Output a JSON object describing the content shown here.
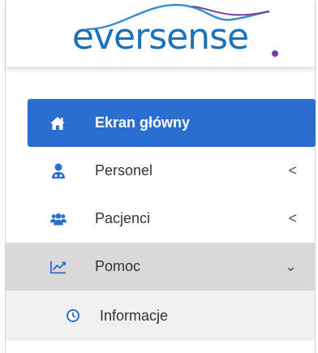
{
  "brand": {
    "logo_text": "eversense",
    "colors": {
      "primary": "#1a73b8",
      "accent": "#7b3fa0",
      "active_item_bg": "#2a6fcf",
      "expanded_item_bg": "#d9d9d9",
      "submenu_bg": "#f0f0f0",
      "icon_blue": "#2a6fcf"
    }
  },
  "sidebar": {
    "items": [
      {
        "label": "Ekran główny",
        "icon": "home-icon",
        "active": true,
        "chevron": ""
      },
      {
        "label": "Personel",
        "icon": "user-doctor-icon",
        "active": false,
        "chevron": "<"
      },
      {
        "label": "Pacjenci",
        "icon": "users-icon",
        "active": false,
        "chevron": "<"
      },
      {
        "label": "Pomoc",
        "icon": "line-chart-icon",
        "active": false,
        "expanded": true,
        "chevron": "⌄",
        "children": [
          {
            "label": "Informacje",
            "icon": "clock-icon"
          }
        ]
      }
    ]
  }
}
